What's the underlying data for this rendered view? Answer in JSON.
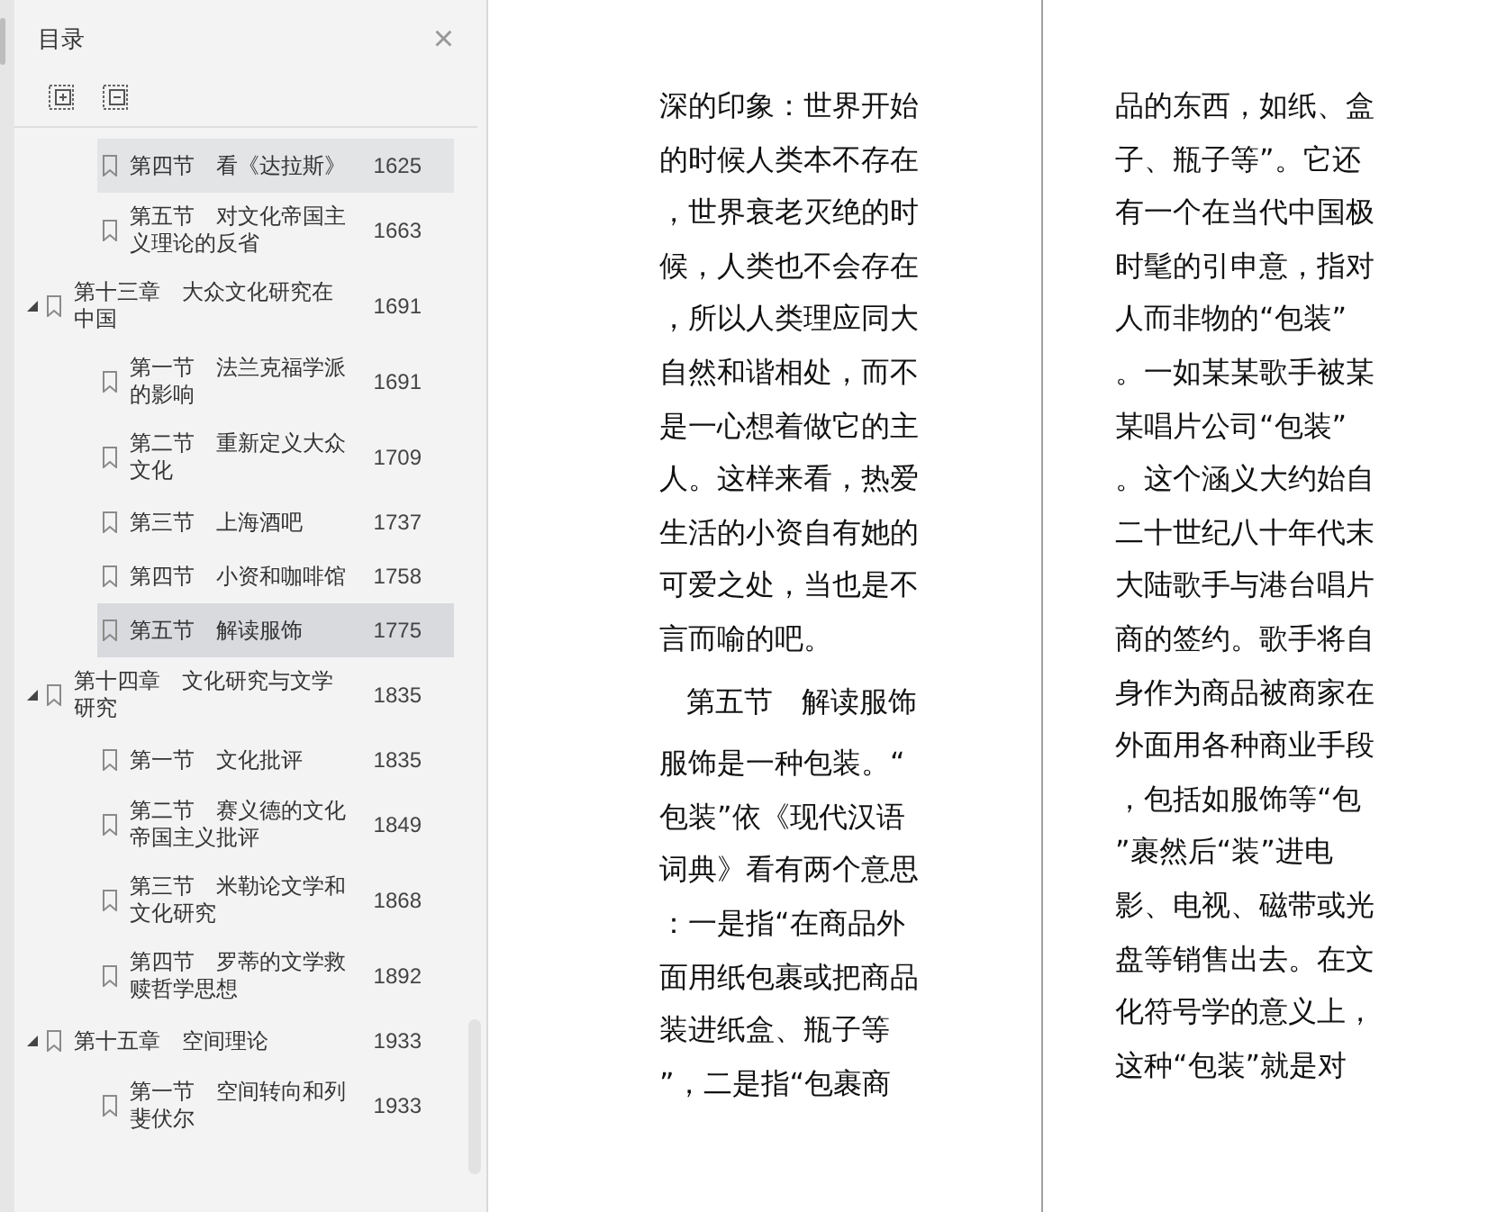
{
  "sidebar": {
    "title": "目录",
    "close": "×",
    "toc": [
      {
        "kind": "section",
        "title": "第四节　看《达拉斯》",
        "page": "1625",
        "selected": false,
        "hovered": true
      },
      {
        "kind": "section",
        "title": "第五节　对文化帝国主义理论的反省",
        "page": "1663",
        "selected": false,
        "hovered": false
      },
      {
        "kind": "chapter",
        "title": "第十三章　大众文化研究在中国",
        "page": "1691",
        "selected": false,
        "hovered": false,
        "expanded": true,
        "children": [
          {
            "title": "第一节　法兰克福学派的影响",
            "page": "1691",
            "selected": false,
            "hovered": false
          },
          {
            "title": "第二节　重新定义大众文化",
            "page": "1709",
            "selected": false,
            "hovered": false
          },
          {
            "title": "第三节　上海酒吧",
            "page": "1737",
            "selected": false,
            "hovered": false
          },
          {
            "title": "第四节　小资和咖啡馆",
            "page": "1758",
            "selected": false,
            "hovered": false
          },
          {
            "title": "第五节　解读服饰",
            "page": "1775",
            "selected": true,
            "hovered": false
          }
        ]
      },
      {
        "kind": "chapter",
        "title": "第十四章　文化研究与文学研究",
        "page": "1835",
        "selected": false,
        "hovered": false,
        "expanded": true,
        "children": [
          {
            "title": "第一节　文化批评",
            "page": "1835",
            "selected": false,
            "hovered": false
          },
          {
            "title": "第二节　赛义德的文化帝国主义批评",
            "page": "1849",
            "selected": false,
            "hovered": false
          },
          {
            "title": "第三节　米勒论文学和文化研究",
            "page": "1868",
            "selected": false,
            "hovered": false
          },
          {
            "title": "第四节　罗蒂的文学救赎哲学思想",
            "page": "1892",
            "selected": false,
            "hovered": false
          }
        ]
      },
      {
        "kind": "chapter",
        "title": "第十五章　空间理论",
        "page": "1933",
        "selected": false,
        "hovered": false,
        "expanded": true,
        "children": [
          {
            "title": "第一节　空间转向和列斐伏尔",
            "page": "1933",
            "selected": false,
            "hovered": false
          }
        ]
      }
    ]
  },
  "pages": [
    {
      "blocks": [
        {
          "kind": "para",
          "lines": [
            "深的印象：世界开始",
            "的时候人类本不存在",
            "，世界衰老灭绝的时",
            "候，人类也不会存在",
            "，所以人类理应同大",
            "自然和谐相处，而不",
            "是一心想着做它的主",
            "人。这样来看，热爱",
            "生活的小资自有她的",
            "可爱之处，当也是不",
            "言而喻的吧。"
          ]
        },
        {
          "kind": "heading",
          "lines": [
            "第五节　解读服饰"
          ]
        },
        {
          "kind": "para",
          "lines": [
            "服饰是一种包装。“",
            "包装”依《现代汉语",
            "词典》看有两个意思",
            "：一是指“在商品外",
            "面用纸包裹或把商品",
            "装进纸盒、瓶子等",
            "”，二是指“包裹商"
          ]
        }
      ]
    },
    {
      "blocks": [
        {
          "kind": "para",
          "lines": [
            "品的东西，如纸、盒",
            "子、瓶子等”。它还",
            "有一个在当代中国极",
            "时髦的引申意，指对",
            "人而非物的“包装”",
            "。一如某某歌手被某",
            "某唱片公司“包装”",
            "。这个涵义大约始自",
            "二十世纪八十年代末",
            "大陆歌手与港台唱片",
            "商的签约。歌手将自",
            "身作为商品被商家在",
            "外面用各种商业手段",
            "，包括如服饰等“包",
            "”裹然后“装”进电",
            "影、电视、磁带或光",
            "盘等销售出去。在文",
            "化符号学的意义上，",
            "这种“包装”就是对"
          ]
        }
      ]
    }
  ]
}
